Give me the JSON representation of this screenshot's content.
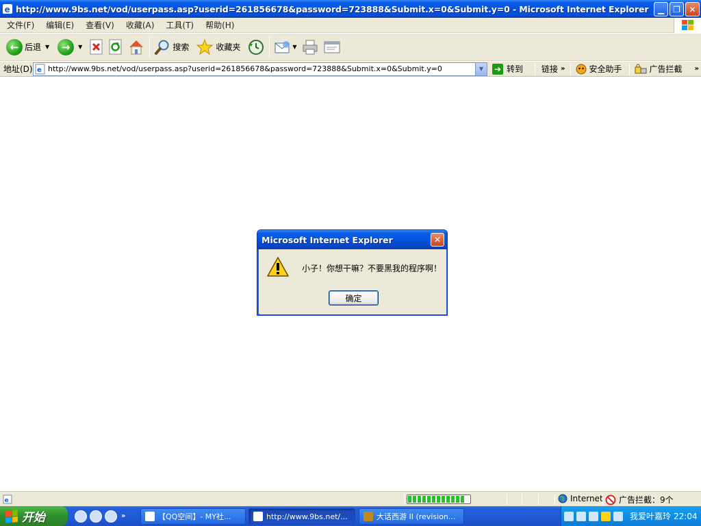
{
  "window": {
    "title": "http://www.9bs.net/vod/userpass.asp?userid=261856678&password=723888&Submit.x=0&Submit.y=0 - Microsoft Internet Explorer"
  },
  "menu": {
    "items": [
      "文件(F)",
      "编辑(E)",
      "查看(V)",
      "收藏(A)",
      "工具(T)",
      "帮助(H)"
    ]
  },
  "toolbar": {
    "back_label": "后退",
    "search_label": "搜索",
    "favorites_label": "收藏夹"
  },
  "address": {
    "label": "地址(D)",
    "url": "http://www.9bs.net/vod/userpass.asp?userid=261856678&password=723888&Submit.x=0&Submit.y=0",
    "go_label": "转到",
    "links_label": "链接",
    "security_label": "安全助手",
    "adblock_label": "广告拦截"
  },
  "dialog": {
    "title": "Microsoft Internet Explorer",
    "message": "小子！你想干嘛？不要黑我的程序啊！",
    "ok_label": "确定"
  },
  "status": {
    "progress": 0.92,
    "zone_label": "Internet",
    "adblock_status": "广告拦截：9个"
  },
  "taskbar": {
    "start_label": "开始",
    "tasks": [
      "【QQ空间】- MY社...",
      "http://www.9bs.net/...",
      "大话西游 II (revision..."
    ],
    "tray_user": "我爱叶嘉玲",
    "clock": "22:04"
  },
  "colors": {
    "xp_blue": "#0a5fe8",
    "face": "#ece9d8",
    "close_red": "#c8461f",
    "start_green": "#2d8f2d"
  }
}
